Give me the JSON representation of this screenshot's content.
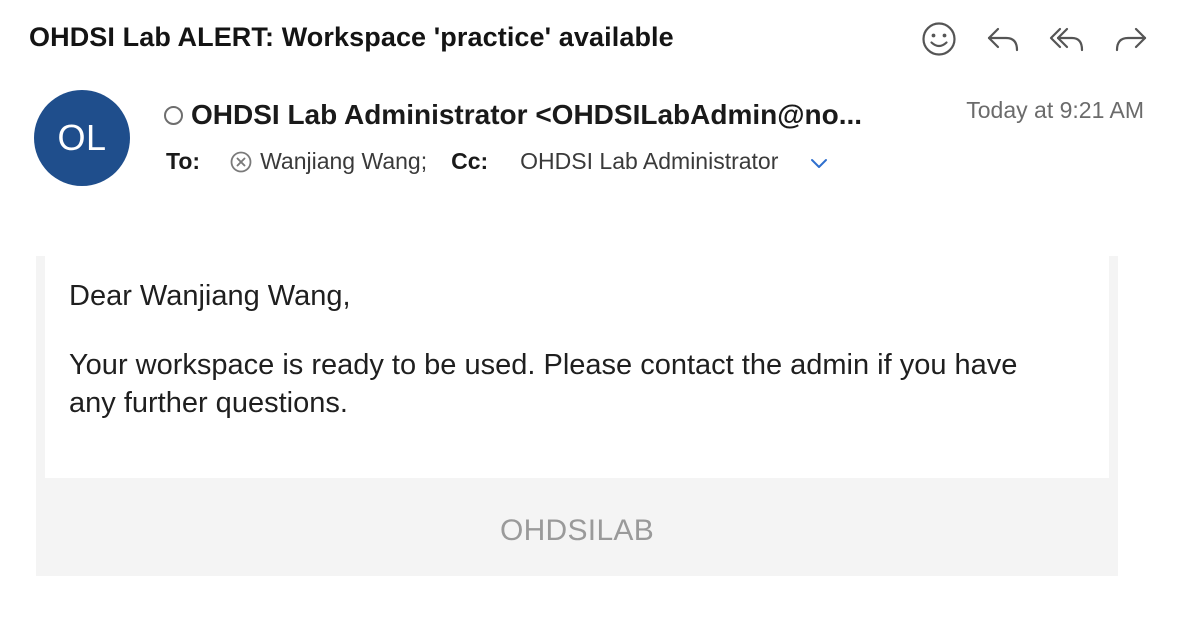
{
  "message": {
    "subject": "OHDSI Lab ALERT: Workspace 'practice' available",
    "received": "Today at 9:21 AM"
  },
  "toolbar": {
    "emoji_icon": "smiley-icon",
    "reply_icon": "reply-icon",
    "reply_all_icon": "reply-all-icon",
    "forward_icon": "forward-icon"
  },
  "sender": {
    "initials": "OL",
    "display": "OHDSI Lab Administrator <OHDSILabAdmin@no...",
    "avatar_color": "#1f4e8c"
  },
  "recipients": {
    "to_label": "To:",
    "to_name": "Wanjiang Wang;",
    "cc_label": "Cc:",
    "cc_name": "OHDSI Lab Administrator"
  },
  "body": {
    "greeting": "Dear Wanjiang Wang,",
    "text": "Your workspace is ready to be used. Please contact the admin if you have any further questions.",
    "footer": "OHDSILAB"
  },
  "colors": {
    "accent": "#2f6fce",
    "frame_bg": "#f4f4f4",
    "muted_text": "#6b6b6b"
  }
}
